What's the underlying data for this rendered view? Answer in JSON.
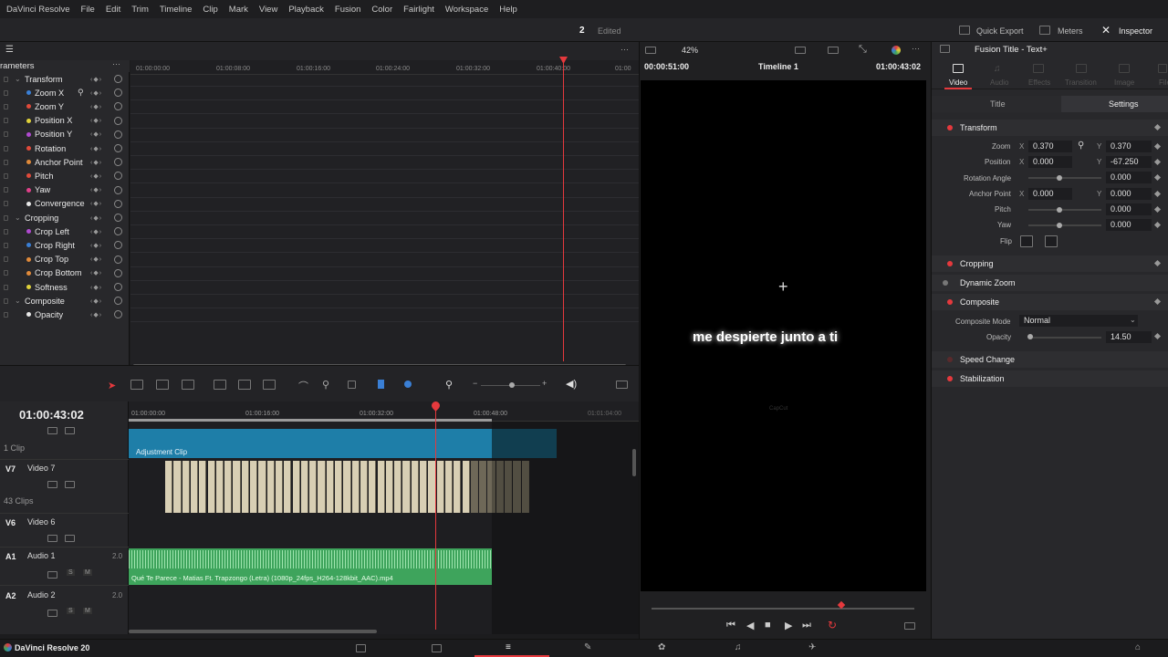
{
  "menu": {
    "app": "DaVinci Resolve",
    "items": [
      "File",
      "Edit",
      "Trim",
      "Timeline",
      "Clip",
      "Mark",
      "View",
      "Playback",
      "Fusion",
      "Color",
      "Fairlight",
      "Workspace",
      "Help"
    ]
  },
  "topbar": {
    "project_num": "2",
    "project_status": "Edited",
    "quick_export": "Quick Export",
    "meters": "Meters",
    "inspector": "Inspector"
  },
  "params": {
    "header": "rameters",
    "ruler": [
      "01:00:00:00",
      "01:00:08:00",
      "01:00:16:00",
      "01:00:24:00",
      "01:00:32:00",
      "01:00:40:00",
      "01:00"
    ],
    "rows": [
      {
        "label": "Transform",
        "group": true
      },
      {
        "label": "Zoom X",
        "color": "#3a7fd5",
        "link": true
      },
      {
        "label": "Zoom Y",
        "color": "#e04a3a"
      },
      {
        "label": "Position X",
        "color": "#e0d23a"
      },
      {
        "label": "Position Y",
        "color": "#b04ad0"
      },
      {
        "label": "Rotation",
        "color": "#e04a3a"
      },
      {
        "label": "Anchor Point",
        "color": "#e08a3a"
      },
      {
        "label": "Pitch",
        "color": "#e04a3a"
      },
      {
        "label": "Yaw",
        "color": "#e0408a"
      },
      {
        "label": "Convergence",
        "color": "#e8e8e8"
      },
      {
        "label": "Cropping",
        "group": true
      },
      {
        "label": "Crop Left",
        "color": "#b04ad0"
      },
      {
        "label": "Crop Right",
        "color": "#3a7fd5"
      },
      {
        "label": "Crop Top",
        "color": "#e08a3a"
      },
      {
        "label": "Crop Bottom",
        "color": "#e08a3a"
      },
      {
        "label": "Softness",
        "color": "#e0d23a"
      },
      {
        "label": "Composite",
        "group": true
      },
      {
        "label": "Opacity",
        "color": "#e8e8e8"
      }
    ]
  },
  "viewer": {
    "zoom": "42%",
    "timecode_left": "00:00:51:00",
    "timeline_name": "Timeline 1",
    "timecode_right": "01:00:43:02",
    "subtitle": "me despierte junto a ti",
    "watermark": "CapCut"
  },
  "timeline": {
    "timecode": "01:00:43:02",
    "ruler": [
      "01:00:00:00",
      "01:00:16:00",
      "01:00:32:00",
      "01:00:48:00",
      "01:01:04:00"
    ],
    "tracks": [
      {
        "id": "",
        "name": "",
        "count": "1 Clip"
      },
      {
        "id": "V7",
        "name": "Video 7",
        "count": "43 Clips"
      },
      {
        "id": "V6",
        "name": "Video 6",
        "count": ""
      },
      {
        "id": "A1",
        "name": "Audio 1",
        "ch": "2.0"
      },
      {
        "id": "A2",
        "name": "Audio 2",
        "ch": "2.0"
      }
    ],
    "adjustment_clip": "Adjustment Clip",
    "audio_clip": "Qué Te Parece - Matias Ft. Trapzongo (Letra) (1080p_24fps_H264-128kbit_AAC).mp4"
  },
  "inspector": {
    "title": "Fusion Title - Text+",
    "tabs": [
      "Video",
      "Audio",
      "Effects",
      "Transition",
      "Image",
      "File"
    ],
    "subtabs": [
      "Title",
      "Settings"
    ],
    "transform": "Transform",
    "zoom_label": "Zoom",
    "zoom_x": "0.370",
    "zoom_y": "0.370",
    "position_label": "Position",
    "pos_x": "0.000",
    "pos_y": "-67.250",
    "rotation_label": "Rotation Angle",
    "rotation": "0.000",
    "anchor_label": "Anchor Point",
    "anchor_x": "0.000",
    "anchor_y": "0.000",
    "pitch_label": "Pitch",
    "pitch": "0.000",
    "yaw_label": "Yaw",
    "yaw": "0.000",
    "flip_label": "Flip",
    "x": "X",
    "y": "Y",
    "cropping": "Cropping",
    "dynamic_zoom": "Dynamic Zoom",
    "composite": "Composite",
    "composite_mode_label": "Composite Mode",
    "composite_mode": "Normal",
    "opacity_label": "Opacity",
    "opacity": "14.50",
    "speed_change": "Speed Change",
    "stabilization": "Stabilization"
  },
  "bottom": {
    "app_version": "DaVinci Resolve 20"
  },
  "colors": {
    "accent_red": "#e5393d",
    "adjustment_clip": "#1e7ea8",
    "audio_clip": "#3ea45c",
    "video_clip": "#d8cfb4"
  }
}
